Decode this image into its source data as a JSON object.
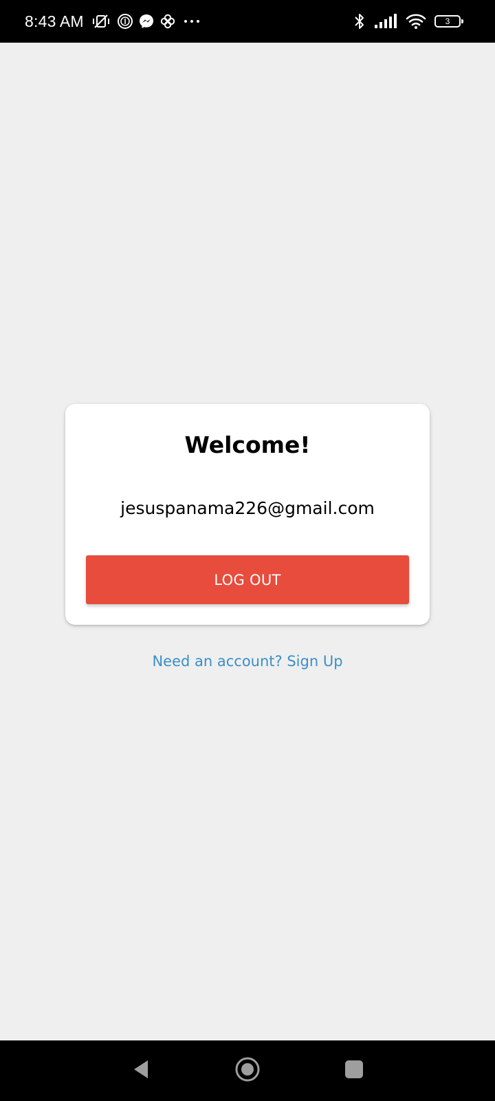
{
  "status_bar": {
    "time": "8:43 AM",
    "battery_level": "3",
    "left_icons": [
      "vibrate-off-icon",
      "fingerprint-icon",
      "messenger-icon",
      "pinwheel-icon",
      "more-dots-icon"
    ],
    "right_icons": [
      "bluetooth-icon",
      "signal-icon",
      "wifi-icon",
      "battery-icon"
    ]
  },
  "card": {
    "title": "Welcome!",
    "email": "jesuspanama226@gmail.com",
    "logout_label": "LOG OUT"
  },
  "signup_link": "Need an account? Sign Up",
  "nav_bar": {
    "buttons": [
      "back-icon",
      "home-icon",
      "recents-icon"
    ]
  },
  "colors": {
    "background": "#efefef",
    "card": "#ffffff",
    "logout_button": "#e74c3c",
    "link": "#3a8fc8",
    "system_bars": "#000000"
  }
}
